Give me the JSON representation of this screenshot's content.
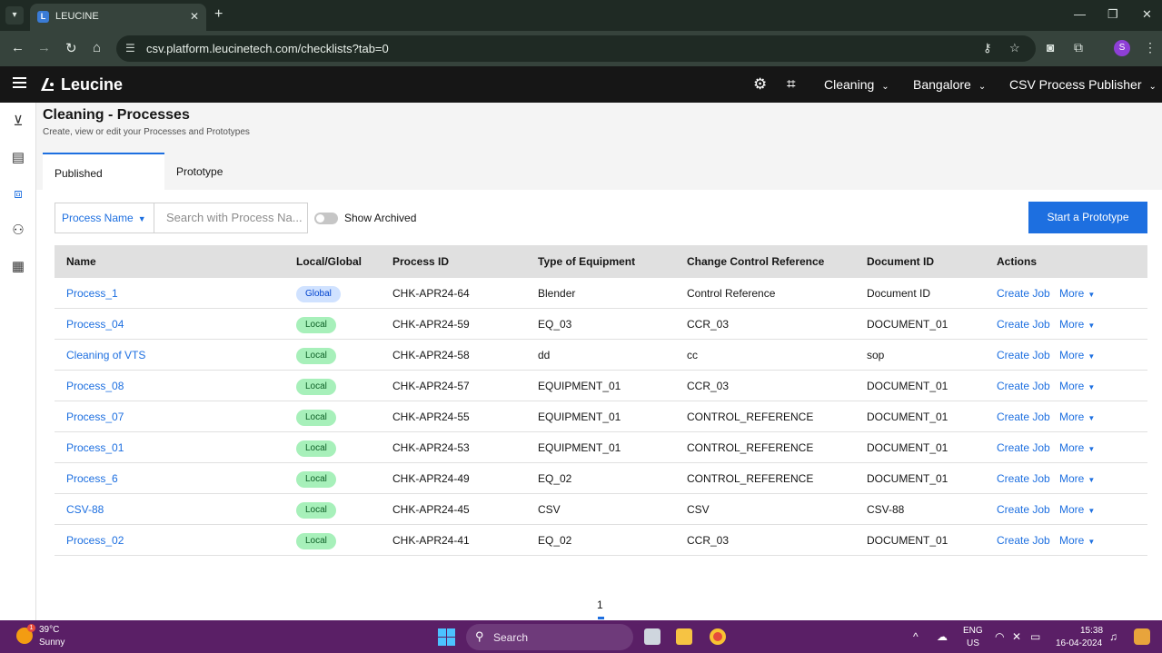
{
  "browser": {
    "tab_title": "LEUCINE",
    "url": "csv.platform.leucinetech.com/checklists?tab=0",
    "profile_initial": "S"
  },
  "app": {
    "brand": "Leucine",
    "facility_dropdown": "Cleaning",
    "site_dropdown": "Bangalore",
    "user_dropdown": "CSV Process Publisher"
  },
  "page": {
    "title": "Cleaning - Processes",
    "subtitle": "Create, view or edit your Processes and Prototypes",
    "tabs": [
      {
        "label": "Published",
        "active": true
      },
      {
        "label": "Prototype",
        "active": false
      }
    ]
  },
  "filters": {
    "field_select": "Process Name",
    "search_placeholder": "Search with Process Na...",
    "show_archived_label": "Show Archived",
    "show_archived": false,
    "primary_button": "Start a Prototype"
  },
  "table": {
    "headers": [
      "Name",
      "Local/Global",
      "Process ID",
      "Type of Equipment",
      "Change Control Reference",
      "Document ID",
      "Actions"
    ],
    "action_create": "Create Job",
    "action_more": "More",
    "rows": [
      {
        "name": "Process_1",
        "scope": "Global",
        "process_id": "CHK-APR24-64",
        "equipment": "Blender",
        "ccr": "Control Reference",
        "document_id": "Document ID"
      },
      {
        "name": "Process_04",
        "scope": "Local",
        "process_id": "CHK-APR24-59",
        "equipment": "EQ_03",
        "ccr": "CCR_03",
        "document_id": "DOCUMENT_01"
      },
      {
        "name": "Cleaning of VTS",
        "scope": "Local",
        "process_id": "CHK-APR24-58",
        "equipment": "dd",
        "ccr": "cc",
        "document_id": "sop"
      },
      {
        "name": "Process_08",
        "scope": "Local",
        "process_id": "CHK-APR24-57",
        "equipment": "EQUIPMENT_01",
        "ccr": "CCR_03",
        "document_id": "DOCUMENT_01"
      },
      {
        "name": "Process_07",
        "scope": "Local",
        "process_id": "CHK-APR24-55",
        "equipment": "EQUIPMENT_01",
        "ccr": "CONTROL_REFERENCE",
        "document_id": "DOCUMENT_01"
      },
      {
        "name": "Process_01",
        "scope": "Local",
        "process_id": "CHK-APR24-53",
        "equipment": "EQUIPMENT_01",
        "ccr": "CONTROL_REFERENCE",
        "document_id": "DOCUMENT_01"
      },
      {
        "name": "Process_6",
        "scope": "Local",
        "process_id": "CHK-APR24-49",
        "equipment": "EQ_02",
        "ccr": "CONTROL_REFERENCE",
        "document_id": "DOCUMENT_01"
      },
      {
        "name": "CSV-88",
        "scope": "Local",
        "process_id": "CHK-APR24-45",
        "equipment": "CSV",
        "ccr": "CSV",
        "document_id": "CSV-88"
      },
      {
        "name": "Process_02",
        "scope": "Local",
        "process_id": "CHK-APR24-41",
        "equipment": "EQ_02",
        "ccr": "CCR_03",
        "document_id": "DOCUMENT_01"
      }
    ]
  },
  "pagination": {
    "current_page": "1"
  },
  "taskbar": {
    "weather_badge": "1",
    "temperature": "39°C",
    "weather": "Sunny",
    "search_label": "Search",
    "language": "ENG",
    "region": "US",
    "time": "15:38",
    "date": "16-04-2024"
  },
  "colors": {
    "accent": "#1d6fe0",
    "header_bg": "#161616",
    "local_badge_bg": "#a7f0ba",
    "global_badge_bg": "#d0e2ff",
    "taskbar_bg": "#5a1f66"
  }
}
